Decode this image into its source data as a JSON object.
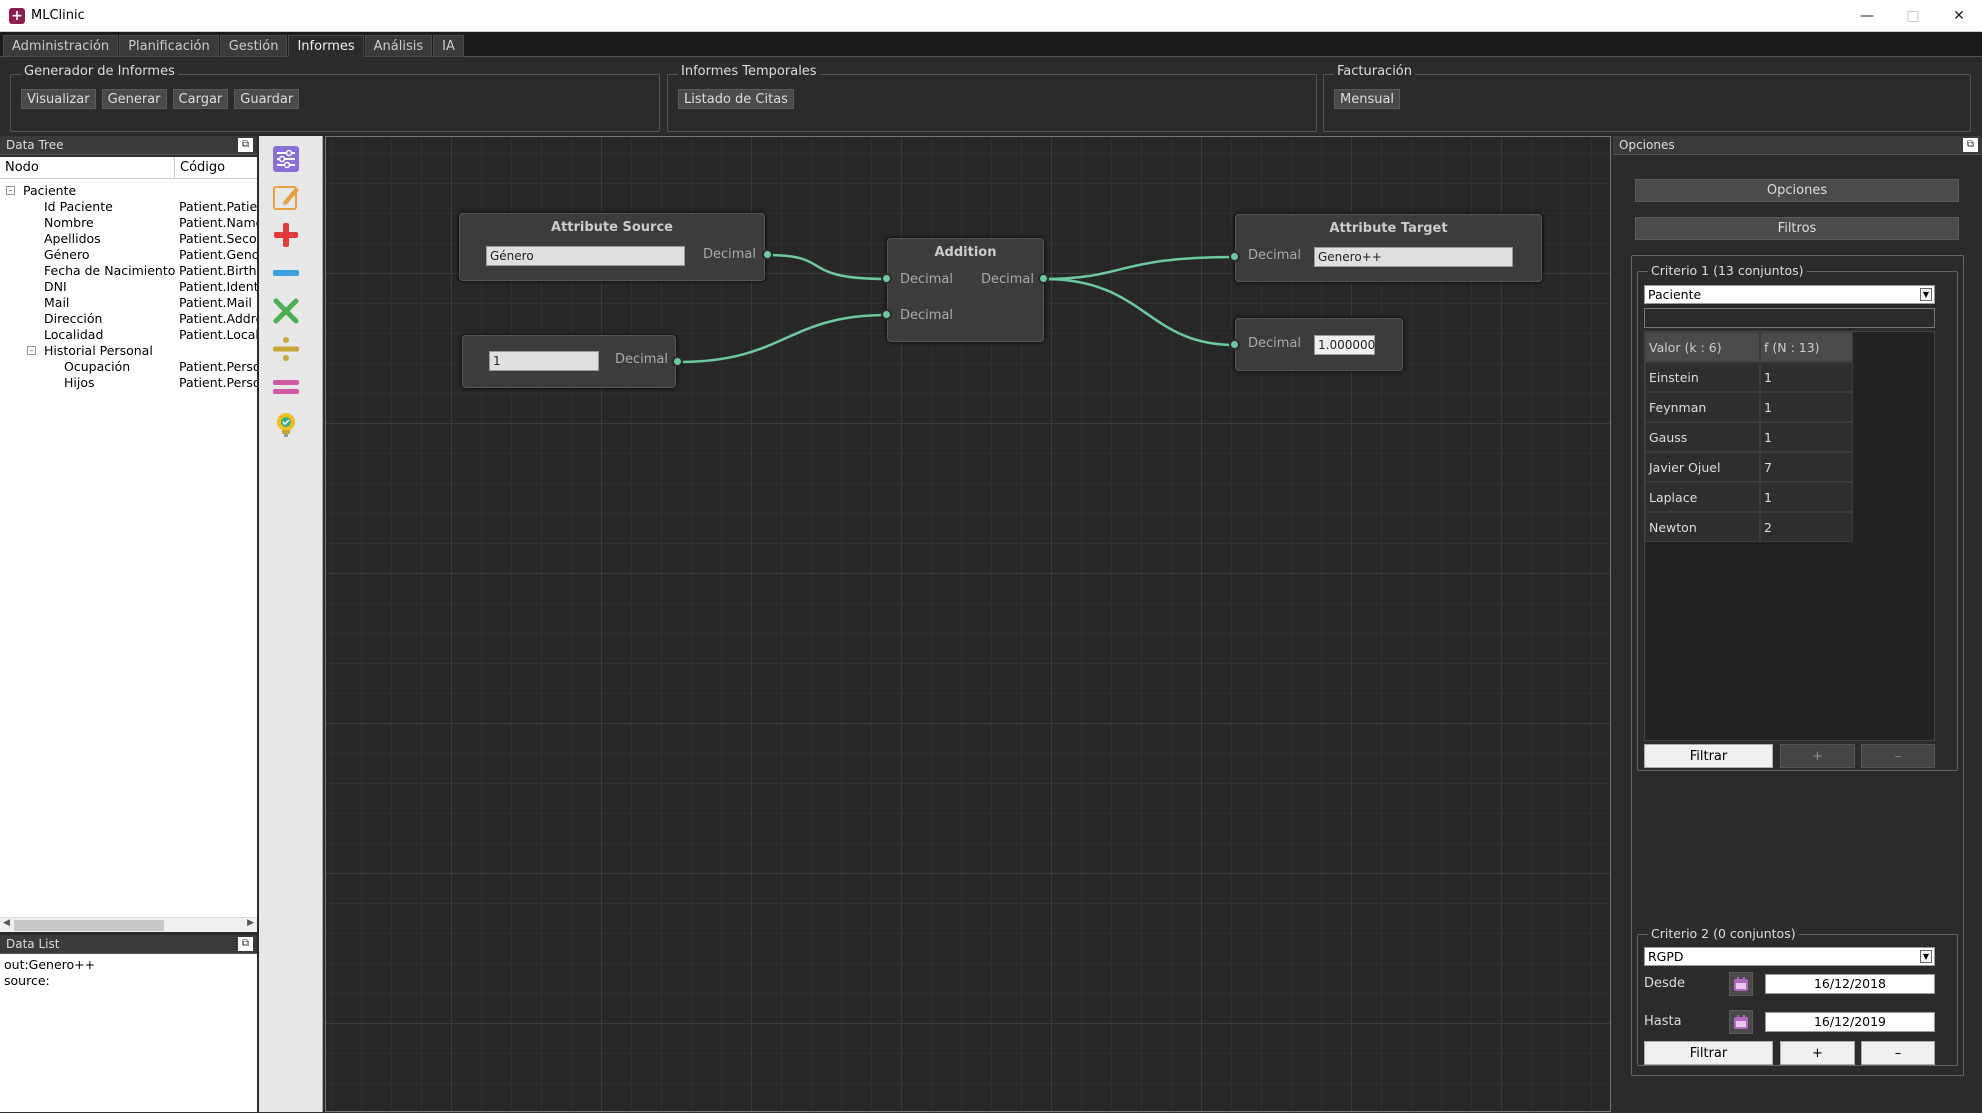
{
  "app": {
    "title": "MLClinic"
  },
  "menu": {
    "tabs": [
      "Administración",
      "Planificación",
      "Gestión",
      "Informes",
      "Análisis",
      "IA"
    ],
    "active": "Informes"
  },
  "ribbon": {
    "groups": [
      {
        "title": "Generador de Informes",
        "buttons": [
          "Visualizar",
          "Generar",
          "Cargar",
          "Guardar"
        ]
      },
      {
        "title": "Informes Temporales",
        "buttons": [
          "Listado de Citas"
        ]
      },
      {
        "title": "Facturación",
        "buttons": [
          "Mensual"
        ]
      }
    ]
  },
  "datatree": {
    "title": "Data Tree",
    "col_node": "Nodo",
    "col_code": "Código",
    "rows": [
      {
        "node": "Paciente",
        "code": ""
      },
      {
        "node": "Id Paciente",
        "code": "Patient.PatientId"
      },
      {
        "node": "Nombre",
        "code": "Patient.Name"
      },
      {
        "node": "Apellidos",
        "code": "Patient.SecondName"
      },
      {
        "node": "Género",
        "code": "Patient.Gender"
      },
      {
        "node": "Fecha de Nacimiento",
        "code": "Patient.Birthdate"
      },
      {
        "node": "DNI",
        "code": "Patient.Identification"
      },
      {
        "node": "Mail",
        "code": "Patient.Mail"
      },
      {
        "node": "Dirección",
        "code": "Patient.Address"
      },
      {
        "node": "Localidad",
        "code": "Patient.Locality"
      },
      {
        "node": "Historial Personal",
        "code": ""
      },
      {
        "node": "Ocupación",
        "code": "Patient.Personal"
      },
      {
        "node": "Hijos",
        "code": "Patient.Personal"
      }
    ]
  },
  "datalist": {
    "title": "Data List",
    "lines": [
      "out:Genero++",
      "source:"
    ]
  },
  "tools": [
    "settings-sliders",
    "edit-pencil",
    "add-plus",
    "subtract-minus",
    "multiply-x",
    "divide",
    "equals",
    "bulb-check"
  ],
  "nodes": {
    "source": {
      "title": "Attribute Source",
      "input": "Género",
      "out_label": "Decimal"
    },
    "constant": {
      "input": "1",
      "out_label": "Decimal"
    },
    "addition": {
      "title": "Addition",
      "in1": "Decimal",
      "in2": "Decimal",
      "out_label": "Decimal"
    },
    "target": {
      "title": "Attribute Target",
      "in_label": "Decimal",
      "input": "Genero++"
    },
    "display": {
      "in_label": "Decimal",
      "value": "1.000000"
    }
  },
  "options": {
    "title": "Opciones",
    "btn_options": "Opciones",
    "btn_filters": "Filtros",
    "criterio1": {
      "title": "Criterio 1 (13 conjuntos)",
      "combo": "Paciente",
      "col_value": "Valor (k : 6)",
      "col_freq": "f (N : 13)",
      "rows": [
        [
          "Einstein",
          "1"
        ],
        [
          "Feynman",
          "1"
        ],
        [
          "Gauss",
          "1"
        ],
        [
          "Javier Ojuel",
          "7"
        ],
        [
          "Laplace",
          "1"
        ],
        [
          "Newton",
          "2"
        ]
      ],
      "filter": "Filtrar",
      "plus": "+",
      "minus": "–"
    },
    "criterio2": {
      "title": "Criterio 2 (0 conjuntos)",
      "combo": "RGPD",
      "desde_label": "Desde",
      "desde": "16/12/2018",
      "hasta_label": "Hasta",
      "hasta": "16/12/2019",
      "filter": "Filtrar",
      "plus": "+",
      "minus": "–"
    }
  }
}
